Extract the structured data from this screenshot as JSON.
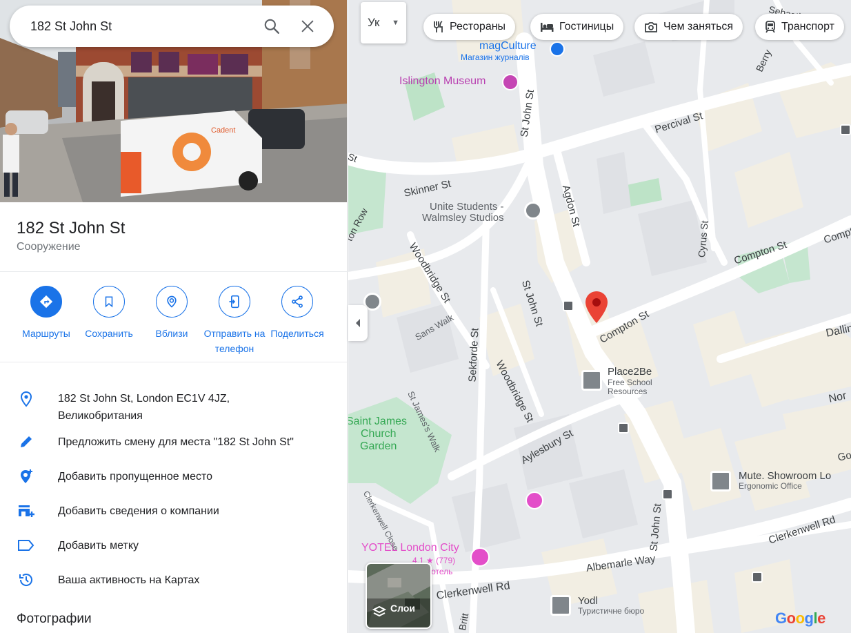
{
  "search": {
    "value": "182 St John St"
  },
  "place": {
    "title": "182 St John St",
    "type": "Сооружение"
  },
  "actions": [
    {
      "label": "Маршруты",
      "icon": "directions-icon"
    },
    {
      "label": "Сохранить",
      "icon": "bookmark-icon"
    },
    {
      "label": "Вблизи",
      "icon": "nearby-icon"
    },
    {
      "label": "Отправить на телефон",
      "icon": "send-to-phone-icon"
    },
    {
      "label": "Поделиться",
      "icon": "share-icon"
    }
  ],
  "info": {
    "address_line1": "182 St John St, London EC1V 4JZ,",
    "address_line2": "Великобритания",
    "suggest_edit": "Предложить смену для места \"182 St John St\"",
    "add_missing": "Добавить пропущенное место",
    "add_business": "Добавить сведения о компании",
    "add_label": "Добавить метку",
    "activity": "Ваша активность на Картах"
  },
  "photos_heading": "Фотографии",
  "hero_van_brand": "Cadent",
  "map": {
    "lang_switch": "Ук",
    "chips": [
      {
        "label": "Рестораны",
        "icon": "restaurant-icon"
      },
      {
        "label": "Гостиницы",
        "icon": "hotel-icon"
      },
      {
        "label": "Чем заняться",
        "icon": "camera-icon"
      },
      {
        "label": "Транспорт",
        "icon": "transit-icon"
      }
    ],
    "layers_label": "Слои",
    "google": "Google",
    "pois": {
      "magculture": "magCulture",
      "magculture_sub": "Магазин журналів",
      "islington_museum": "Islington Museum",
      "unite_1": "Unite Students -",
      "unite_2": "Walmsley Studios",
      "place2be": "Place2Be",
      "place2be_sub1": "Free School",
      "place2be_sub2": "Resources",
      "mute": "Mute. Showroom Lo",
      "mute_sub": "Ergonomic Office",
      "yotel": "YOTEL London City",
      "yotel_rating": "4,1",
      "yotel_reviews": "(779)",
      "yotel_sub": "готель",
      "yodl": "Yodl",
      "yodl_sub": "Туристичне бюро",
      "stjames_1": "Saint James",
      "stjames_2": "Church",
      "stjames_3": "Garden"
    },
    "streets": {
      "st_john_st": "St John St",
      "percival_st": "Percival St",
      "agdon_st": "Agdon St",
      "cyrus_st": "Cyrus St",
      "skinner_st": "Skinner St",
      "woodbridge_st": "Woodbridge St",
      "compton_st": "Compton St",
      "sans_walk": "Sans Walk",
      "sekforde_st": "Sekforde St",
      "aylesbury_st": "Aylesbury St",
      "st_jamess_walk": "St James's Walk",
      "clerkenwell_close": "Clerkenwell Close",
      "clerkenwell_rd": "Clerkenwell Rd",
      "albemarle_way": "Albemarle Way",
      "dalling": "Dalling",
      "norman": "Nor",
      "gosset": "Gos",
      "sebastian": "Sebastian St",
      "berry": "Berry",
      "row": "ton Row",
      "st": "St",
      "britton": "Britt"
    }
  }
}
